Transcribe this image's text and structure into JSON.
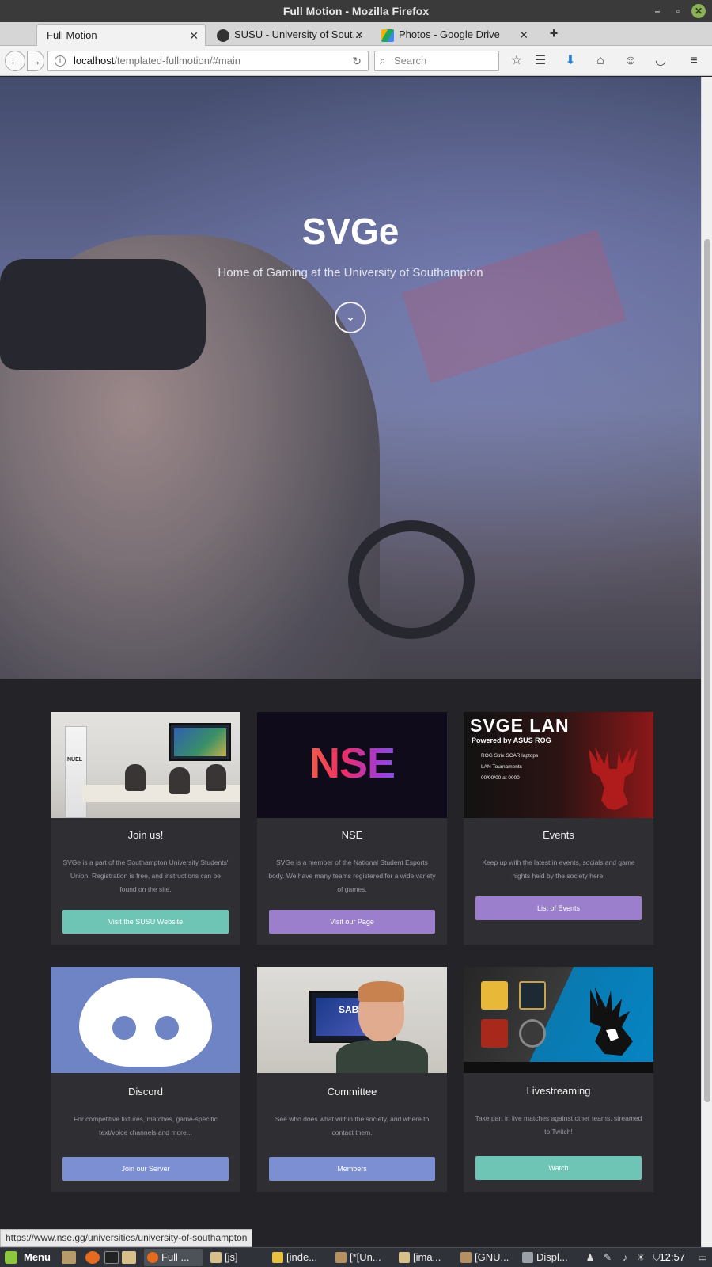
{
  "window": {
    "title": "Full Motion - Mozilla Firefox"
  },
  "tabs": [
    {
      "label": "Full Motion"
    },
    {
      "label": "SUSU - University of Sout..."
    },
    {
      "label": "Photos - Google Drive"
    }
  ],
  "toolbar": {
    "url_host": "localhost",
    "url_path": "/templated-fullmotion/#main",
    "search_placeholder": "Search"
  },
  "hero": {
    "title": "SVGe",
    "subtitle": "Home of Gaming at the University of Southampton"
  },
  "cards": [
    {
      "title": "Join us!",
      "description": "SVGe is a part of the Southampton University Students' Union. Registration is free, and instructions can be found on the site.",
      "button": "Visit the SUSU Website",
      "button_color": "#6ec5b6",
      "thumb_text": "NUEL"
    },
    {
      "title": "NSE",
      "description": "SVGe is a member of the National Student Esports body. We have many teams registered for a wide variety of games.",
      "button": "Visit our Page",
      "button_color": "#9b7fcc",
      "thumb_text": "NSE"
    },
    {
      "title": "Events",
      "description": "Keep up with the latest in events, socials and game nights held by the society here.",
      "button": "List of Events",
      "button_color": "#9b7fcc",
      "thumb_title": "SVGE LAN",
      "thumb_sub": "Powered by ASUS ROG",
      "thumb_lines": [
        "ROG Strix SCAR laptops",
        "LAN Tournaments",
        "00/00/00 at 0000"
      ]
    },
    {
      "title": "Discord",
      "description": "For competitive fixtures, matches, game-specific text/voice channels and more...",
      "button": "Join our Server",
      "button_color": "#7b8fd2"
    },
    {
      "title": "Committee",
      "description": "See who does what within the society, and where to contact them.",
      "button": "Members",
      "button_color": "#7b8fd2",
      "thumb_text": "SABI"
    },
    {
      "title": "Livestreaming",
      "description": "Take part in live matches against other teams, streamed to Twitch!",
      "button": "Watch",
      "button_color": "#6ec5b6"
    }
  ],
  "status_link": "https://www.nse.gg/universities/university-of-southampton",
  "taskbar": {
    "menu_label": "Menu",
    "tasks": [
      "Full ...",
      "[js]",
      "[inde...",
      "[*[Un...",
      "[ima...",
      "[GNU...",
      "Displ..."
    ],
    "clock": "12:57"
  },
  "colors": {
    "page_bg": "#242428",
    "card_bg": "#2e2e33",
    "teal": "#6ec5b6",
    "purple": "#9b7fcc",
    "blue": "#7b8fd2"
  }
}
